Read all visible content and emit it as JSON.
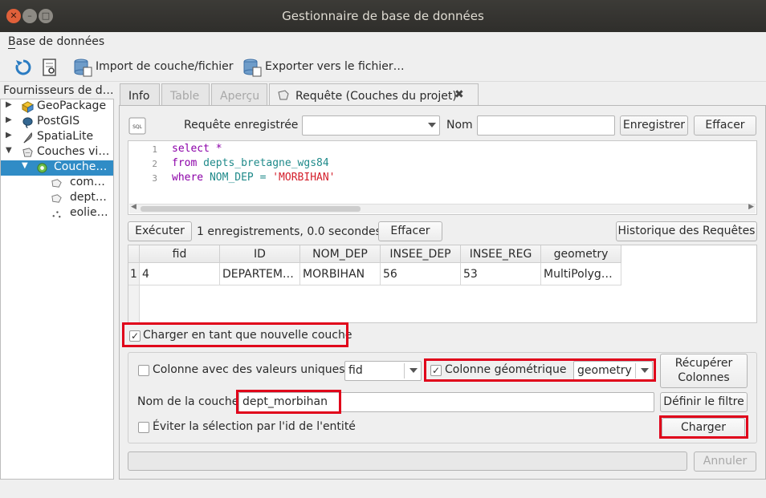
{
  "window": {
    "title": "Gestionnaire de base de données"
  },
  "menubar": {
    "db_menu": "Base de données"
  },
  "toolbar": {
    "import_label": "Import de couche/fichier",
    "export_label": "Exporter vers le fichier…"
  },
  "providers": {
    "header": "Fournisseurs de d…",
    "items": [
      {
        "label": "GeoPackage",
        "icon": "geopackage-icon"
      },
      {
        "label": "PostGIS",
        "icon": "postgis-elephant-icon"
      },
      {
        "label": "SpatiaLite",
        "icon": "spatialite-feather-icon"
      },
      {
        "label": "Couches vi…",
        "icon": "virtual-layers-icon"
      },
      {
        "label": "Couche…",
        "icon": "project-layers-icon"
      },
      {
        "label": "com…",
        "icon": "polygon-layer-icon"
      },
      {
        "label": "dept…",
        "icon": "polygon-layer-icon"
      },
      {
        "label": "eolie…",
        "icon": "point-layer-icon"
      }
    ]
  },
  "tabs": {
    "info": "Info",
    "table": "Table",
    "apercu": "Aperçu",
    "query": "Requête (Couches du projet)"
  },
  "query": {
    "saved_label": "Requête enregistrée",
    "saved_value": "",
    "name_label": "Nom",
    "name_value": "",
    "save_button": "Enregistrer",
    "clear_button": "Effacer",
    "lines": [
      {
        "n": "1",
        "kw": "select",
        "rest": " *",
        "rest_class": "kw"
      },
      {
        "n": "2",
        "kw": "from",
        "rest": " depts_bretagne_wgs84",
        "rest_class": "id"
      },
      {
        "n": "3",
        "kw": "where",
        "rest": " NOM_DEP = ",
        "str": "'MORBIHAN'"
      }
    ]
  },
  "exec": {
    "execute_button": "Exécuter",
    "status": "1 enregistrements, 0.0 secondes",
    "clear_button": "Effacer",
    "history_button": "Historique des Requêtes"
  },
  "results": {
    "columns": [
      "fid",
      "ID",
      "NOM_DEP",
      "INSEE_DEP",
      "INSEE_REG",
      "geometry"
    ],
    "rows": [
      {
        "index": "1",
        "cells": [
          "4",
          "DEPARTEM…",
          "MORBIHAN",
          "56",
          "53",
          "MultiPolyg…"
        ]
      }
    ]
  },
  "options": {
    "load_as_layer": {
      "label": "Charger en tant que nouvelle couche",
      "checked": true
    },
    "unique_column": {
      "label": "Colonne avec des valeurs uniques",
      "checked": false,
      "value": "fid"
    },
    "geom_column": {
      "label": "Colonne géométrique",
      "checked": true,
      "value": "geometry"
    },
    "retrieve_button": "Récupérer\nColonnes",
    "layer_name_label": "Nom de la couche",
    "layer_name_value": "dept_morbihan",
    "filter_button": "Définir le filtre",
    "avoid_selection": {
      "label": "Éviter la sélection par l'id de l'entité",
      "checked": false
    },
    "load_button": "Charger",
    "cancel_button": "Annuler"
  },
  "colors": {
    "highlight": "#e0001a",
    "selection": "#308cc6",
    "titlebar": "#3c3b37"
  }
}
